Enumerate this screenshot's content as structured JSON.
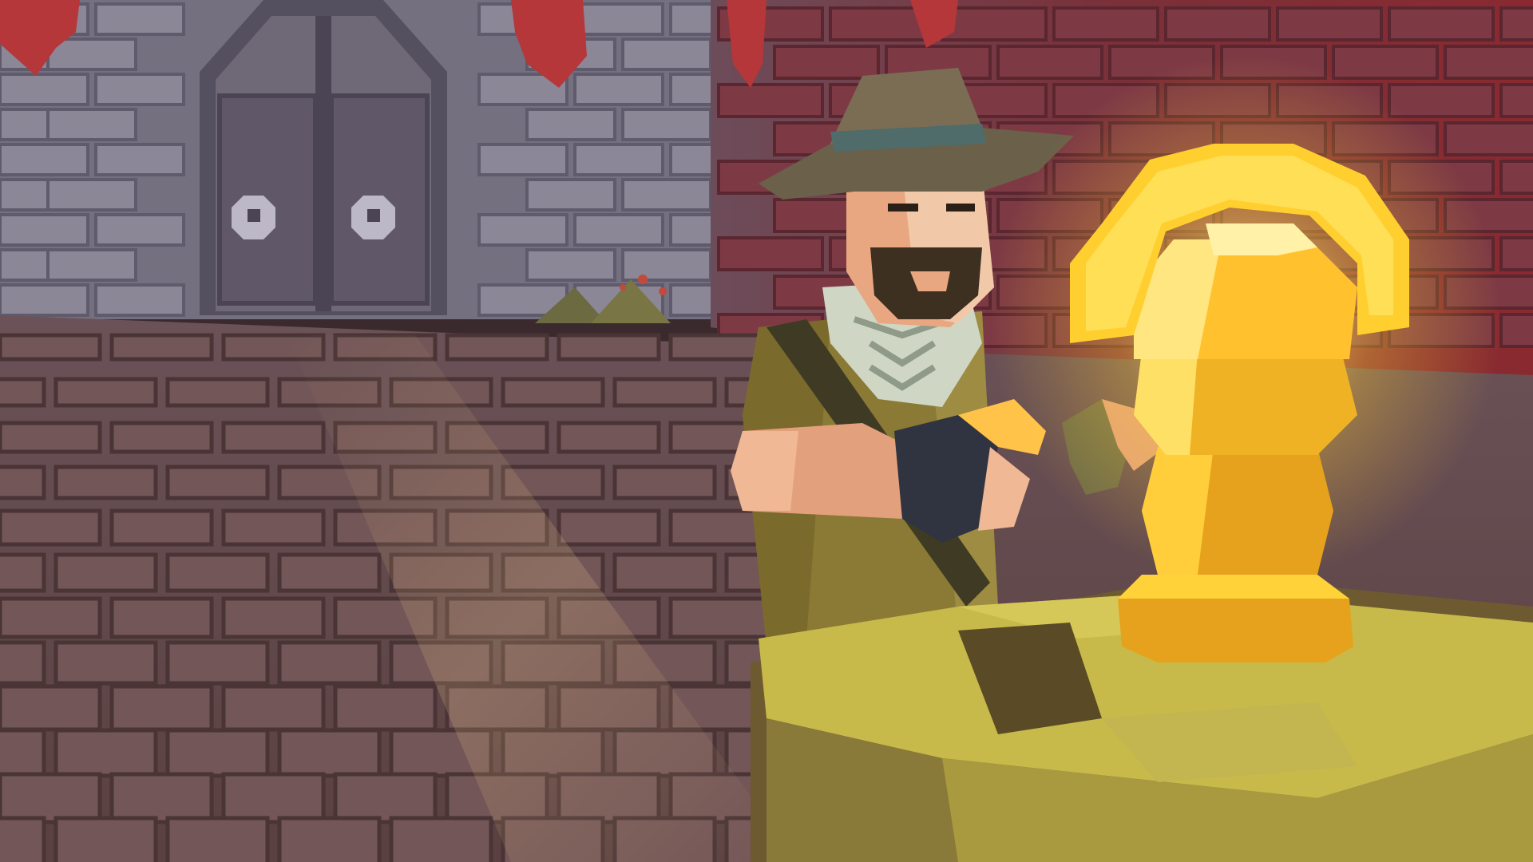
{
  "scene": {
    "kind": "low-poly 3D game render",
    "elements": [
      "castle-wall",
      "wooden-gate",
      "red-banners",
      "cobblestone-courtyard",
      "adventurer-character",
      "golden-idol",
      "stone-pedestal"
    ]
  },
  "palette": {
    "sky_wall_tint": "#6f6a82",
    "brick_light": "#8d8899",
    "brick_dark": "#5d586b",
    "red_wall": "#7a2e36",
    "banner_red": "#b5373a",
    "floor_base": "#5e4648",
    "floor_light": "#7d5a55",
    "gold_bright": "#ffd23a",
    "gold_mid": "#e6a21c",
    "gold_dark": "#a86a12",
    "pedestal_top": "#c7b94a",
    "pedestal_side": "#6e5a30",
    "hat": "#6b6049",
    "hat_band": "#4f6b6a",
    "skin": "#e3a07c",
    "beard": "#3d3020",
    "jacket": "#8a7a35",
    "scarf": "#cfd6c4",
    "glove": "#2f3440"
  }
}
